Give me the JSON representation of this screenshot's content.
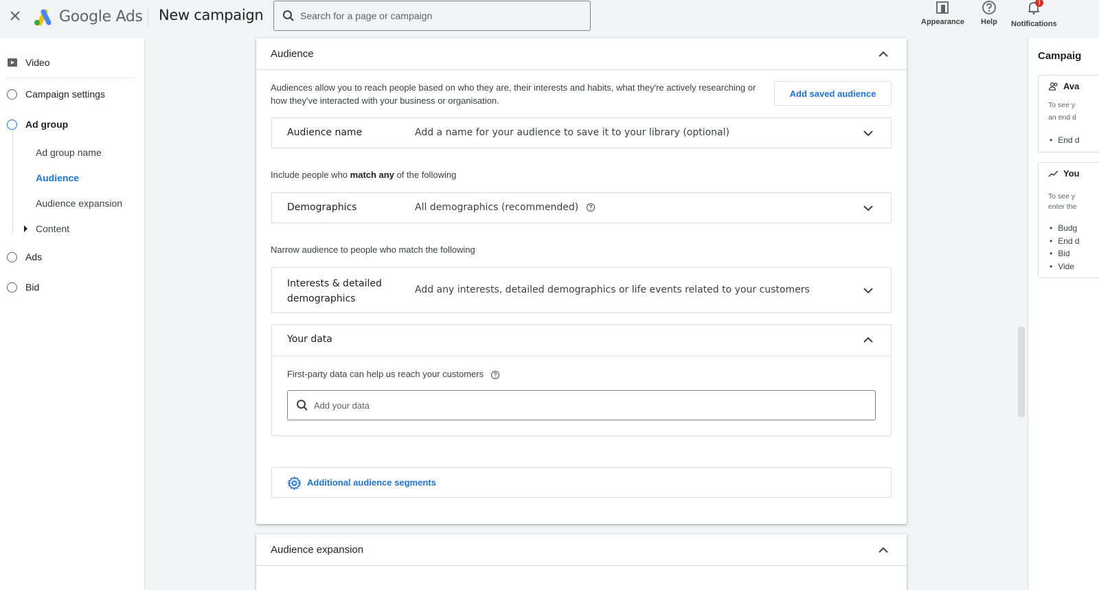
{
  "header": {
    "brand": "Google Ads",
    "page_title": "New campaign",
    "search_placeholder": "Search for a page or campaign",
    "actions": [
      {
        "label": "Appearance",
        "icon": "appearance-icon"
      },
      {
        "label": "Help",
        "icon": "help-icon"
      },
      {
        "label": "Notifications",
        "icon": "bell-icon",
        "badge": "!"
      }
    ]
  },
  "leftnav": {
    "video": "Video",
    "campaign_settings": "Campaign settings",
    "ad_group": "Ad group",
    "sub_items": [
      "Ad group name",
      "Audience",
      "Audience expansion",
      "Content"
    ],
    "ads": "Ads",
    "bid": "Bid"
  },
  "audience_card": {
    "title": "Audience",
    "description": "Audiences allow you to reach people based on who they are, their interests and habits, what they're actively researching or how they've interacted with your business or organisation.",
    "add_saved_button": "Add saved audience",
    "audience_name_label": "Audience name",
    "audience_name_value": "Add a name for your audience to save it to your library (optional)",
    "include_prefix": "Include people who ",
    "include_bold": "match any",
    "include_suffix": " of the following",
    "demographics_label": "Demographics",
    "demographics_value": "All demographics (recommended)",
    "narrow_text": "Narrow audience to people who match the following",
    "interests_label_1": "Interests & detailed",
    "interests_label_2": "demographics",
    "interests_value": "Add any interests, detailed demographics or life events related to your customers",
    "your_data_label": "Your data",
    "first_party_text": "First-party data can help us reach your customers",
    "add_data_placeholder": "Add your data",
    "additional_segments": "Additional audience segments"
  },
  "expansion_card": {
    "title": "Audience expansion"
  },
  "right_panel": {
    "title": "Campaig",
    "card1_head": "Ava",
    "card1_text_1": "To see y",
    "card1_text_2": "an end d",
    "card1_bullet": "End d",
    "card2_head": "You",
    "card2_text_1": "To see y",
    "card2_text_2": "enter the",
    "card2_bullets": [
      "Budg",
      "End d",
      "Bid",
      "Vide"
    ]
  },
  "colors": {
    "accent": "#1a73e8",
    "text": "#3c4043",
    "border": "#dadce0",
    "notification": "#d93025"
  }
}
